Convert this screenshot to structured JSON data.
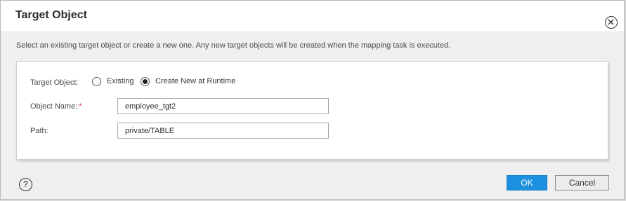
{
  "dialog": {
    "title": "Target Object",
    "instructions": "Select an existing target object or create a new one. Any new target objects will be created when the mapping task is executed."
  },
  "form": {
    "target_object_label": "Target Object:",
    "options": [
      {
        "label": "Existing",
        "selected": false
      },
      {
        "label": "Create New at Runtime",
        "selected": true
      }
    ],
    "object_name_label": "Object Name:",
    "object_name_required_mark": "*",
    "object_name_value": "employee_tgt2",
    "path_label": "Path:",
    "path_value": "private/TABLE"
  },
  "footer": {
    "help_symbol": "?",
    "ok_label": "OK",
    "cancel_label": "Cancel"
  },
  "colors": {
    "primary_button": "#1e90e0",
    "required_mark": "#d9342b"
  },
  "icons": [
    "close-icon",
    "help-icon"
  ]
}
